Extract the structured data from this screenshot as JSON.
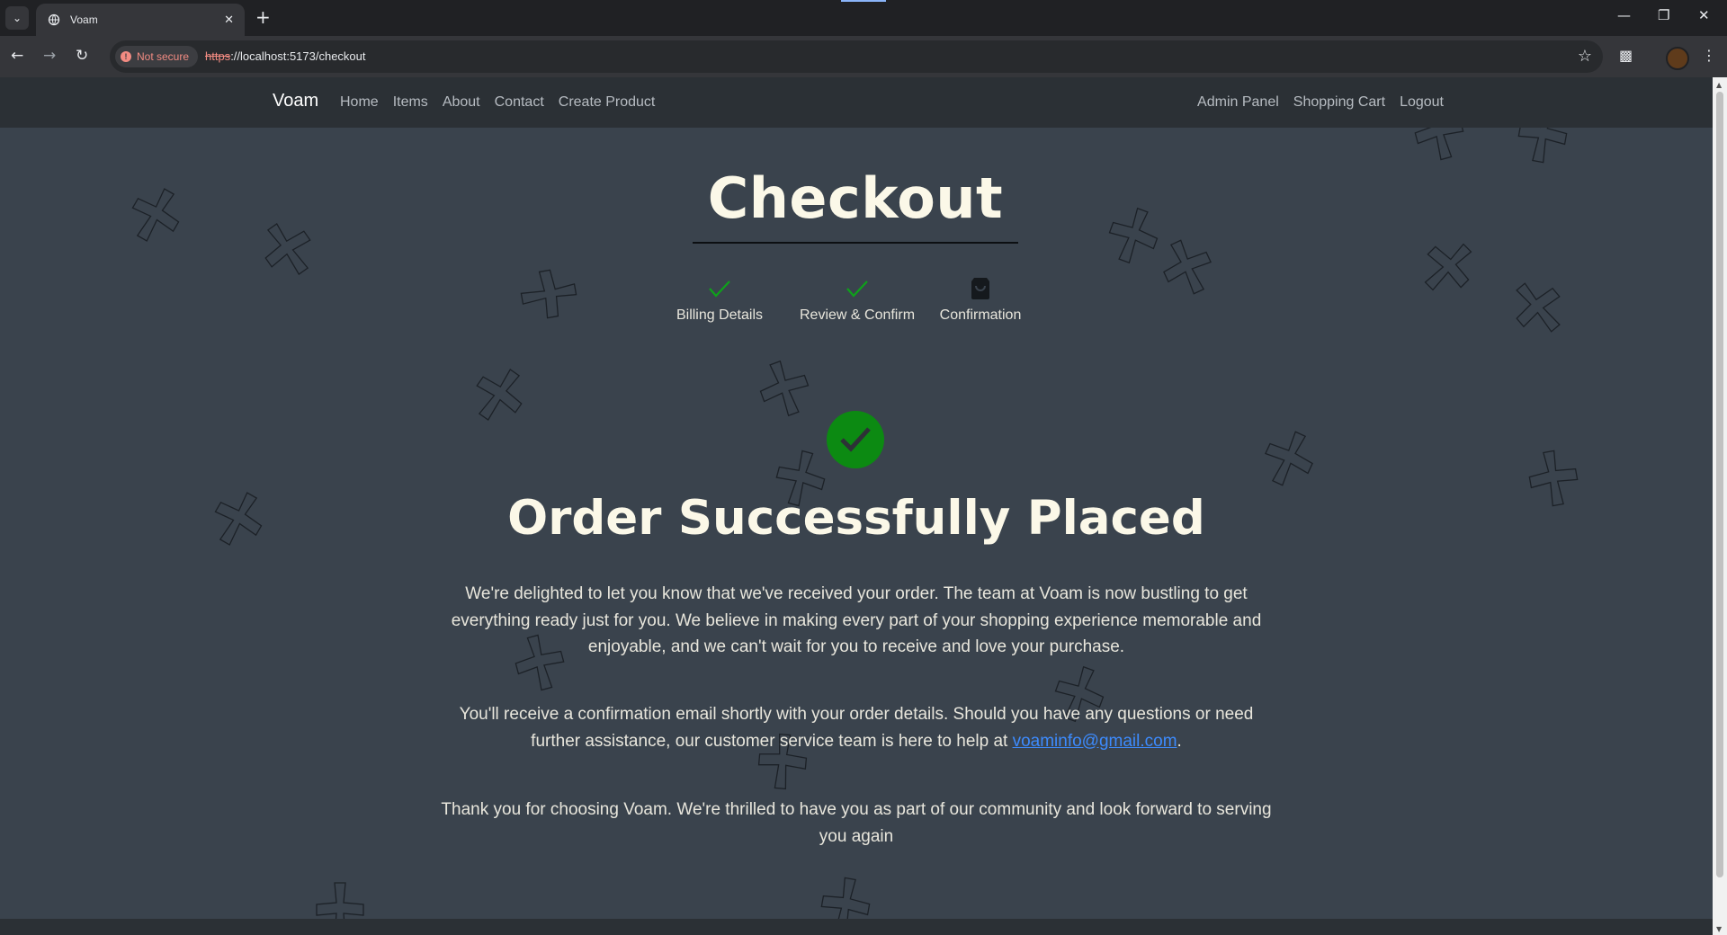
{
  "browser": {
    "tab_title": "Voam",
    "security_label": "Not secure",
    "url_scheme": "https",
    "url_rest": "://localhost:5173/checkout"
  },
  "navbar": {
    "brand": "Voam",
    "links": [
      "Home",
      "Items",
      "About",
      "Contact",
      "Create Product"
    ],
    "right_links": [
      "Admin Panel",
      "Shopping Cart",
      "Logout"
    ]
  },
  "checkout": {
    "title": "Checkout",
    "steps": [
      {
        "label": "Billing Details",
        "icon": "check-icon",
        "status": "complete"
      },
      {
        "label": "Review & Confirm",
        "icon": "check-icon",
        "status": "complete"
      },
      {
        "label": "Confirmation",
        "icon": "shopping-bag-icon",
        "status": "current"
      }
    ],
    "headline": "Order Successfully Placed",
    "paragraph1": "We're delighted to let you know that we've received your order. The team at Voam is now bustling to get everything ready just for you. We believe in making every part of your shopping experience memorable and enjoyable, and we can't wait for you to receive and love your purchase.",
    "paragraph2_before": "You'll receive a confirmation email shortly with your order details. Should you have any questions or need further assistance, our customer service team is here to help at ",
    "email": "voaminfo@gmail.com",
    "paragraph2_after": ".",
    "paragraph3": "Thank you for choosing Voam. We're thrilled to have you as part of our community and look forward to serving you again"
  },
  "colors": {
    "background": "#3a434d",
    "navbar": "#2b3035",
    "success_green": "#0c8a12",
    "title_text": "#fbf8e8",
    "link_blue": "#3d8bfd"
  }
}
